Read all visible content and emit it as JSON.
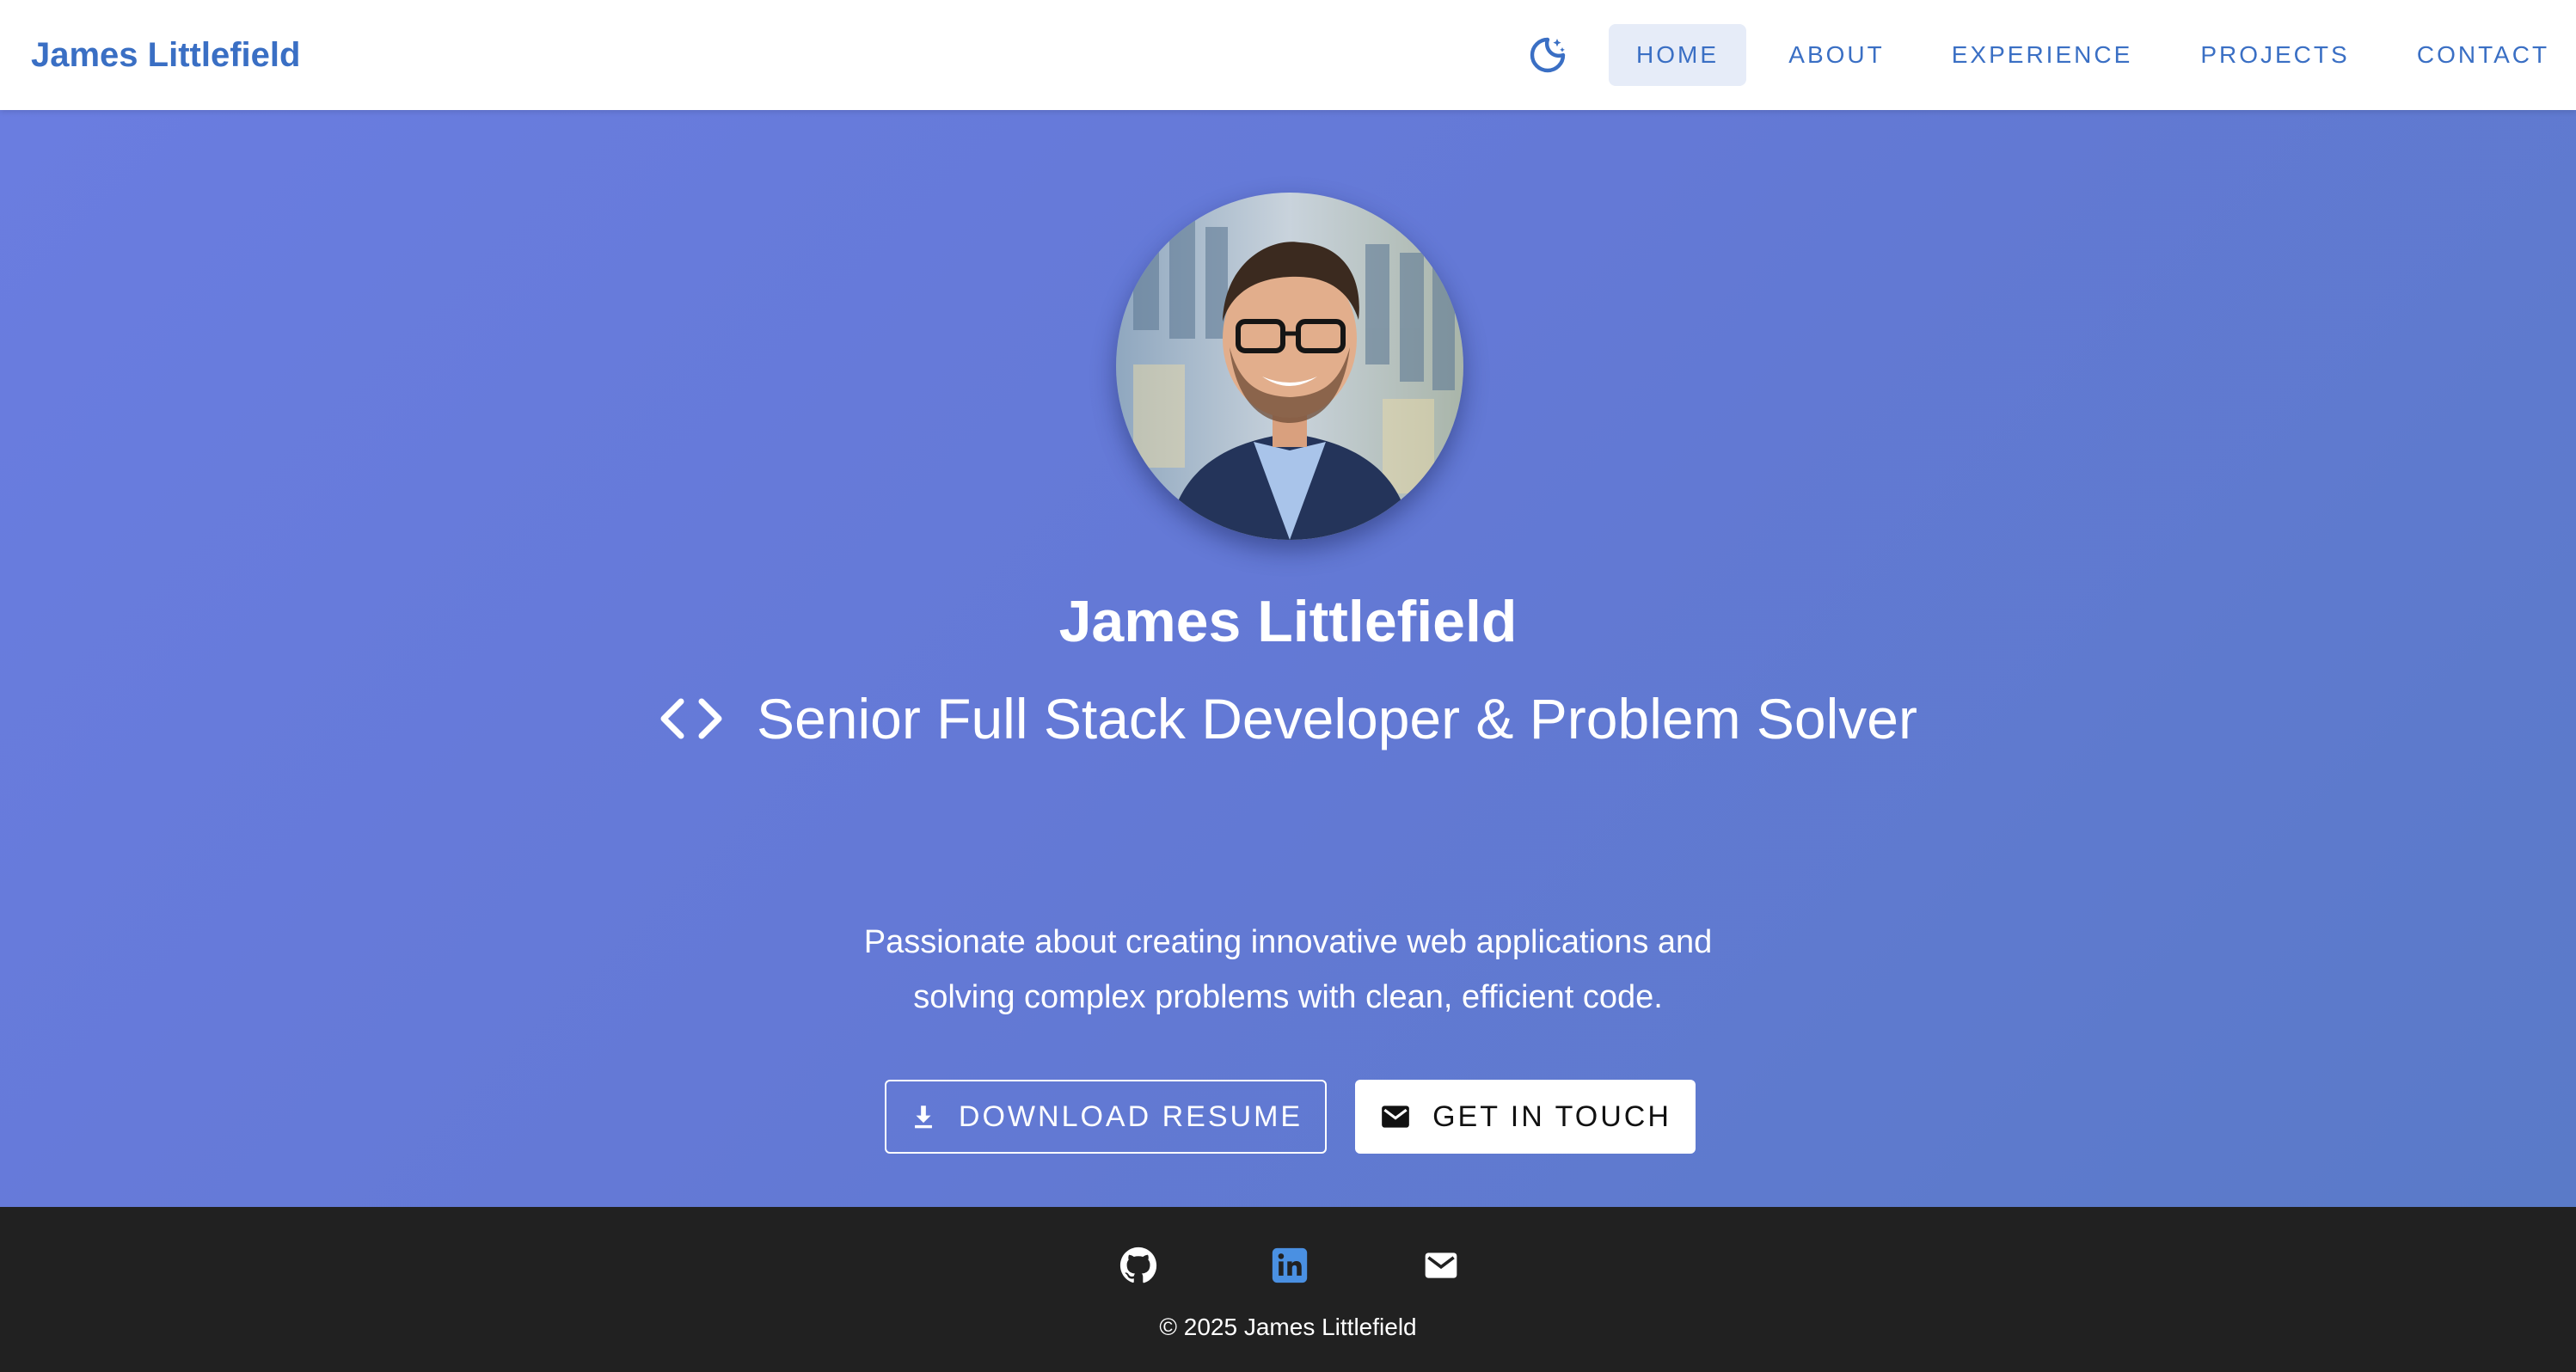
{
  "nav": {
    "brand": "James Littlefield",
    "theme_icon": "dark-mode-icon",
    "links": [
      "HOME",
      "ABOUT",
      "EXPERIENCE",
      "PROJECTS",
      "CONTACT"
    ],
    "active": "HOME"
  },
  "hero": {
    "name": "James Littlefield",
    "title": "Senior Full Stack Developer & Problem Solver",
    "title_icon": "code-icon",
    "description": "Passionate about creating innovative web applications and solving complex problems with clean, efficient code.",
    "buttons": {
      "resume": "DOWNLOAD RESUME",
      "contact": "GET IN TOUCH"
    }
  },
  "footer": {
    "social": [
      "github-icon",
      "linkedin-icon",
      "email-icon"
    ],
    "copyright": "© 2025 James Littlefield"
  },
  "colors": {
    "accent": "#3a6fc4",
    "hero_gradient_start": "#6a7de0",
    "hero_gradient_end": "#5a7ac8",
    "footer_bg": "#212121",
    "linkedin": "#4a90e2"
  }
}
